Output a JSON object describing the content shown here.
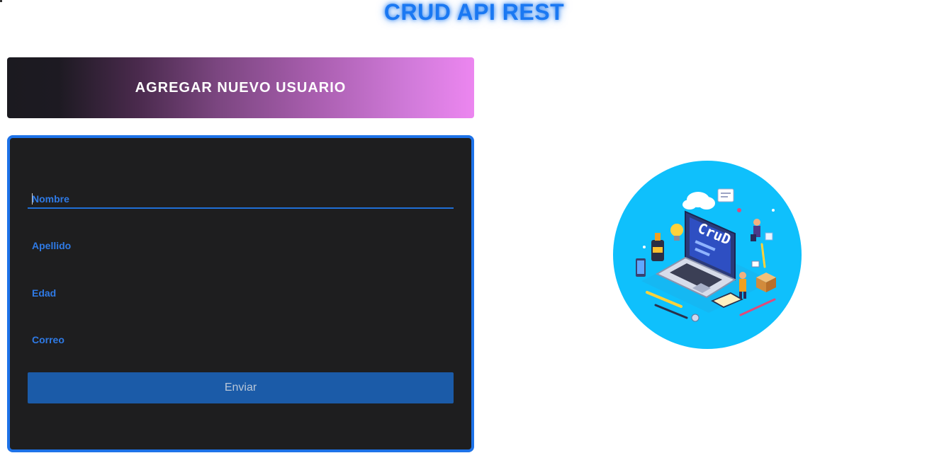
{
  "header": {
    "title": "CRUD API REST"
  },
  "banner": {
    "title": "AGREGAR NUEVO USUARIO"
  },
  "form": {
    "fields": [
      {
        "placeholder": "Nombre",
        "value": ""
      },
      {
        "placeholder": "Apellido",
        "value": ""
      },
      {
        "placeholder": "Edad",
        "value": ""
      },
      {
        "placeholder": "Correo",
        "value": ""
      }
    ],
    "submit_label": "Enviar"
  },
  "illustration": {
    "icon": "crud-laptop-illustration",
    "text": "CruD"
  },
  "colors": {
    "accent": "#1d72e8",
    "card_bg": "#1e1e1f",
    "button_bg": "#1b5ba8",
    "illustration_bg": "#0fc0fc"
  }
}
